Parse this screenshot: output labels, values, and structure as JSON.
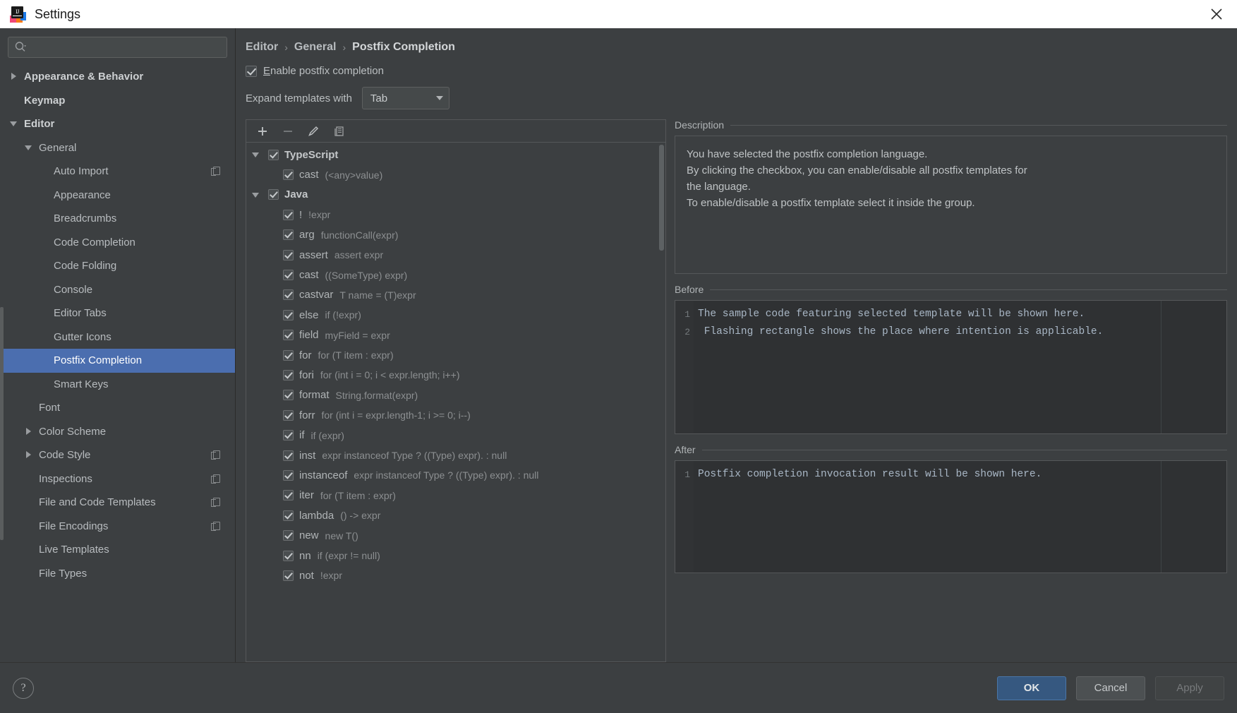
{
  "window": {
    "title": "Settings",
    "logo_text": "IJ",
    "close_icon": "close-icon"
  },
  "search": {
    "placeholder": "",
    "value": "",
    "icon": "search-icon"
  },
  "sidebar": {
    "items": [
      {
        "label": "Appearance & Behavior",
        "indent": 0,
        "twisty": "collapsed",
        "bold": true,
        "selected": false,
        "badge": false
      },
      {
        "label": "Keymap",
        "indent": 0,
        "twisty": "none",
        "bold": true,
        "selected": false,
        "badge": false
      },
      {
        "label": "Editor",
        "indent": 0,
        "twisty": "expanded",
        "bold": true,
        "selected": false,
        "badge": false
      },
      {
        "label": "General",
        "indent": 1,
        "twisty": "expanded",
        "bold": false,
        "selected": false,
        "badge": false
      },
      {
        "label": "Auto Import",
        "indent": 2,
        "twisty": "none",
        "bold": false,
        "selected": false,
        "badge": true
      },
      {
        "label": "Appearance",
        "indent": 2,
        "twisty": "none",
        "bold": false,
        "selected": false,
        "badge": false
      },
      {
        "label": "Breadcrumbs",
        "indent": 2,
        "twisty": "none",
        "bold": false,
        "selected": false,
        "badge": false
      },
      {
        "label": "Code Completion",
        "indent": 2,
        "twisty": "none",
        "bold": false,
        "selected": false,
        "badge": false
      },
      {
        "label": "Code Folding",
        "indent": 2,
        "twisty": "none",
        "bold": false,
        "selected": false,
        "badge": false
      },
      {
        "label": "Console",
        "indent": 2,
        "twisty": "none",
        "bold": false,
        "selected": false,
        "badge": false
      },
      {
        "label": "Editor Tabs",
        "indent": 2,
        "twisty": "none",
        "bold": false,
        "selected": false,
        "badge": false
      },
      {
        "label": "Gutter Icons",
        "indent": 2,
        "twisty": "none",
        "bold": false,
        "selected": false,
        "badge": false
      },
      {
        "label": "Postfix Completion",
        "indent": 2,
        "twisty": "none",
        "bold": false,
        "selected": true,
        "badge": false
      },
      {
        "label": "Smart Keys",
        "indent": 2,
        "twisty": "none",
        "bold": false,
        "selected": false,
        "badge": false
      },
      {
        "label": "Font",
        "indent": 1,
        "twisty": "none",
        "bold": false,
        "selected": false,
        "badge": false
      },
      {
        "label": "Color Scheme",
        "indent": 1,
        "twisty": "collapsed",
        "bold": false,
        "selected": false,
        "badge": false
      },
      {
        "label": "Code Style",
        "indent": 1,
        "twisty": "collapsed",
        "bold": false,
        "selected": false,
        "badge": true
      },
      {
        "label": "Inspections",
        "indent": 1,
        "twisty": "none",
        "bold": false,
        "selected": false,
        "badge": true
      },
      {
        "label": "File and Code Templates",
        "indent": 1,
        "twisty": "none",
        "bold": false,
        "selected": false,
        "badge": true
      },
      {
        "label": "File Encodings",
        "indent": 1,
        "twisty": "none",
        "bold": false,
        "selected": false,
        "badge": true
      },
      {
        "label": "Live Templates",
        "indent": 1,
        "twisty": "none",
        "bold": false,
        "selected": false,
        "badge": false
      },
      {
        "label": "File Types",
        "indent": 1,
        "twisty": "none",
        "bold": false,
        "selected": false,
        "badge": false
      }
    ]
  },
  "breadcrumb": {
    "items": [
      "Editor",
      "General",
      "Postfix Completion"
    ],
    "separator": "›"
  },
  "options": {
    "enable_checkbox": {
      "label_mnemonic": "E",
      "label_rest": "nable postfix completion",
      "checked": true
    },
    "expand_label": "Expand templates with",
    "expand_value": "Tab"
  },
  "list_toolbar": {
    "add": "add-icon",
    "remove": "remove-icon",
    "edit": "edit-icon",
    "duplicate": "duplicate-icon"
  },
  "templates": [
    {
      "type": "group",
      "key": "TypeScript",
      "desc": "",
      "checked": true,
      "expanded": true
    },
    {
      "type": "item",
      "key": "cast",
      "desc": "(<any>value)",
      "checked": true
    },
    {
      "type": "group",
      "key": "Java",
      "desc": "",
      "checked": true,
      "expanded": true
    },
    {
      "type": "item",
      "key": "!",
      "desc": "!expr",
      "checked": true
    },
    {
      "type": "item",
      "key": "arg",
      "desc": "functionCall(expr)",
      "checked": true
    },
    {
      "type": "item",
      "key": "assert",
      "desc": "assert expr",
      "checked": true
    },
    {
      "type": "item",
      "key": "cast",
      "desc": "((SomeType) expr)",
      "checked": true
    },
    {
      "type": "item",
      "key": "castvar",
      "desc": "T name = (T)expr",
      "checked": true
    },
    {
      "type": "item",
      "key": "else",
      "desc": "if (!expr)",
      "checked": true
    },
    {
      "type": "item",
      "key": "field",
      "desc": "myField = expr",
      "checked": true
    },
    {
      "type": "item",
      "key": "for",
      "desc": "for (T item : expr)",
      "checked": true
    },
    {
      "type": "item",
      "key": "fori",
      "desc": "for (int i = 0; i < expr.length; i++)",
      "checked": true
    },
    {
      "type": "item",
      "key": "format",
      "desc": "String.format(expr)",
      "checked": true
    },
    {
      "type": "item",
      "key": "forr",
      "desc": "for (int i = expr.length-1; i >= 0; i--)",
      "checked": true
    },
    {
      "type": "item",
      "key": "if",
      "desc": "if (expr)",
      "checked": true
    },
    {
      "type": "item",
      "key": "inst",
      "desc": "expr instanceof Type ? ((Type) expr). : null",
      "checked": true
    },
    {
      "type": "item",
      "key": "instanceof",
      "desc": "expr instanceof Type ? ((Type) expr). : null",
      "checked": true
    },
    {
      "type": "item",
      "key": "iter",
      "desc": "for (T item : expr)",
      "checked": true
    },
    {
      "type": "item",
      "key": "lambda",
      "desc": "() -> expr",
      "checked": true
    },
    {
      "type": "item",
      "key": "new",
      "desc": "new T()",
      "checked": true
    },
    {
      "type": "item",
      "key": "nn",
      "desc": "if (expr != null)",
      "checked": true
    },
    {
      "type": "item",
      "key": "not",
      "desc": "!expr",
      "checked": true
    }
  ],
  "description": {
    "title": "Description",
    "lines": [
      "You have selected the postfix completion language.",
      "By clicking the checkbox, you can enable/disable all postfix templates for",
      "the language.",
      "To enable/disable a postfix template select it inside the group."
    ]
  },
  "before": {
    "title": "Before",
    "lines": [
      {
        "num": "1",
        "text": "The sample code featuring selected template will be shown here."
      },
      {
        "num": "2",
        "text": " Flashing rectangle shows the place where intention is applicable."
      }
    ]
  },
  "after": {
    "title": "After",
    "lines": [
      {
        "num": "1",
        "text": "Postfix completion invocation result will be shown here."
      }
    ]
  },
  "footer": {
    "help": "?",
    "ok": "OK",
    "cancel": "Cancel",
    "apply": "Apply"
  },
  "colors": {
    "accent": "#4b6eaf",
    "primary_button": "#365880",
    "panel_bg": "#3c3f41",
    "code_bg": "#2f3133"
  }
}
